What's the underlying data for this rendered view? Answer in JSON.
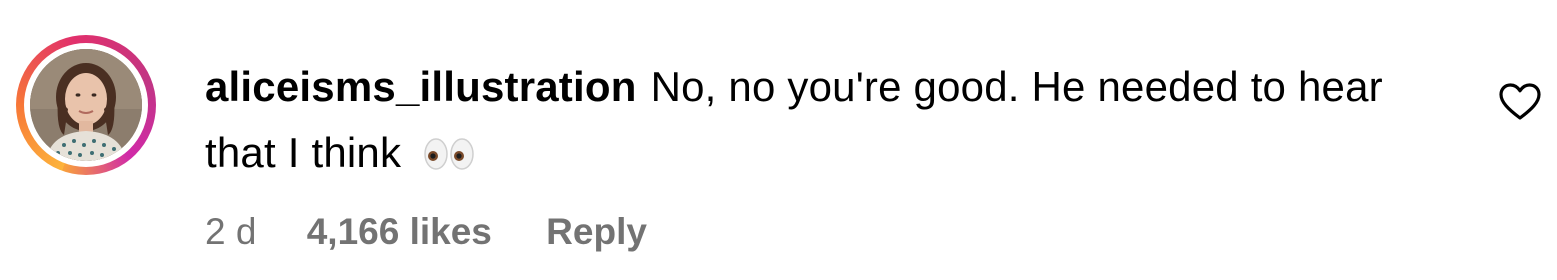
{
  "comment": {
    "username": "aliceisms_illustration",
    "text": "No, no you're good. He needed to hear that I think",
    "emoji": "eyes",
    "timestamp": "2 d",
    "likes": "4,166 likes",
    "reply_label": "Reply"
  },
  "colors": {
    "text": "#000000",
    "meta": "#737373",
    "ring_start": "#fdb43b",
    "ring_end": "#d02aa8"
  },
  "icons": {
    "like": "heart-outline-icon",
    "emoji": "eyes-emoji-icon"
  }
}
